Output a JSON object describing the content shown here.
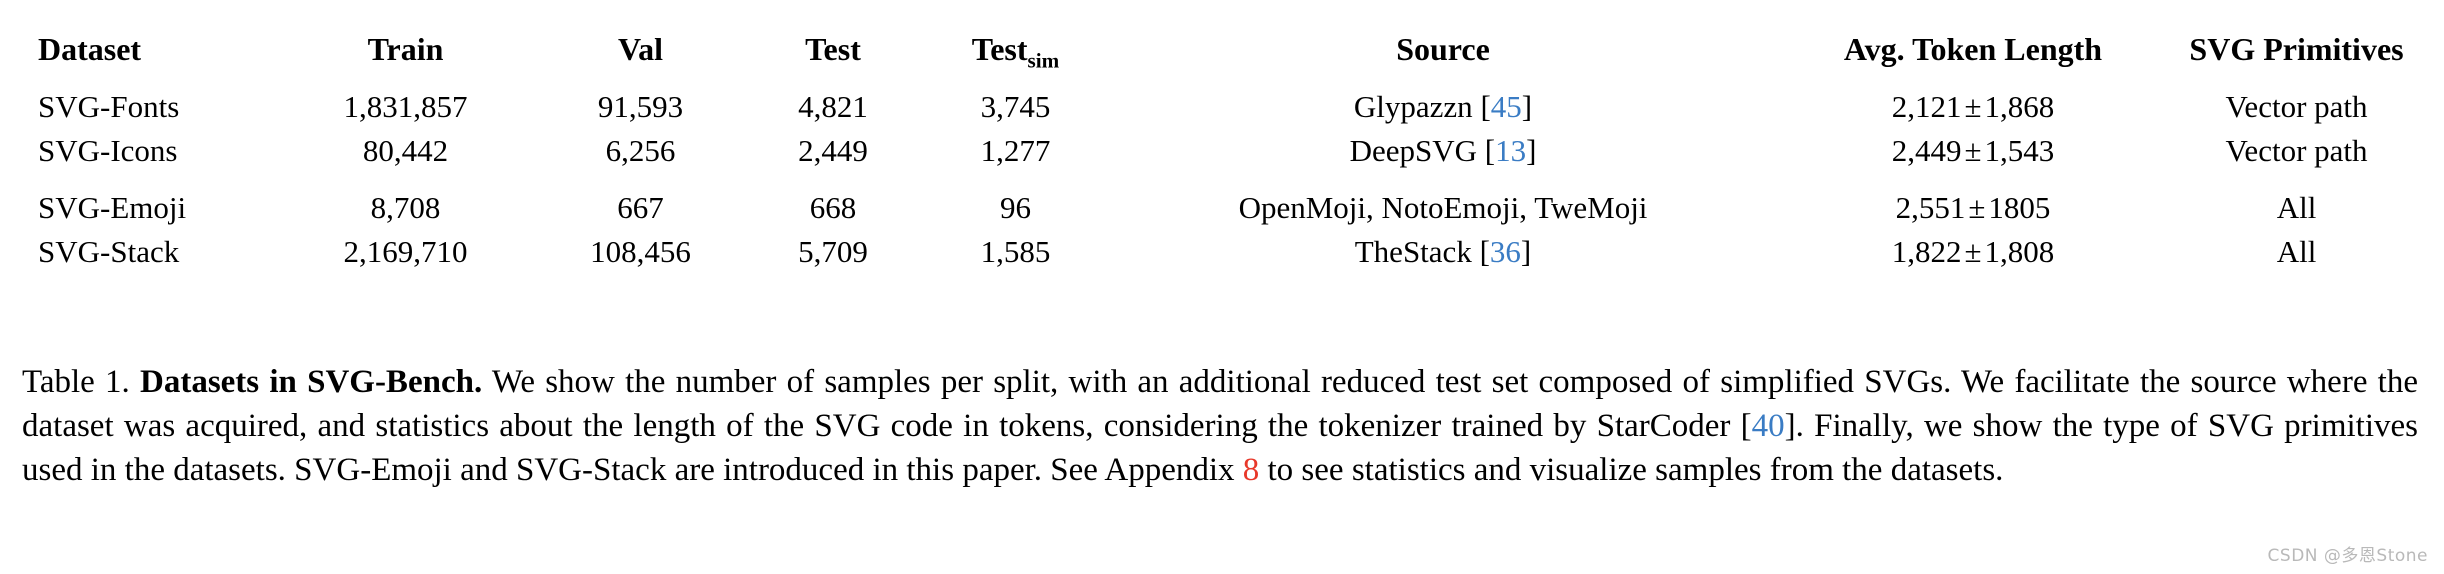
{
  "table": {
    "columns": [
      {
        "key": "dataset",
        "label": "Dataset"
      },
      {
        "key": "train",
        "label": "Train"
      },
      {
        "key": "val",
        "label": "Val"
      },
      {
        "key": "test",
        "label": "Test"
      },
      {
        "key": "testsim",
        "label": "Test",
        "sub": "sim"
      },
      {
        "key": "source",
        "label": "Source"
      },
      {
        "key": "tokens",
        "label": "Avg. Token Length"
      },
      {
        "key": "primitives",
        "label": "SVG Primitives"
      }
    ],
    "rows": [
      {
        "dataset": "SVG-Fonts",
        "train": "1,831,857",
        "val": "91,593",
        "test": "4,821",
        "testsim": "3,745",
        "source_text": "Glypazzn",
        "source_cite": "45",
        "tokens_mean": "2,121",
        "tokens_std": "1,868",
        "primitives": "Vector path"
      },
      {
        "dataset": "SVG-Icons",
        "train": "80,442",
        "val": "6,256",
        "test": "2,449",
        "testsim": "1,277",
        "source_text": "DeepSVG",
        "source_cite": "13",
        "tokens_mean": "2,449",
        "tokens_std": "1,543",
        "primitives": "Vector path"
      },
      {
        "dataset": "SVG-Emoji",
        "train": "8,708",
        "val": "667",
        "test": "668",
        "testsim": "96",
        "source_text": "OpenMoji, NotoEmoji, TweMoji",
        "source_cite": "",
        "tokens_mean": "2,551",
        "tokens_std": "1805",
        "primitives": "All"
      },
      {
        "dataset": "SVG-Stack",
        "train": "2,169,710",
        "val": "108,456",
        "test": "5,709",
        "testsim": "1,585",
        "source_text": "TheStack",
        "source_cite": "36",
        "tokens_mean": "1,822",
        "tokens_std": "1,808",
        "primitives": "All"
      }
    ]
  },
  "caption": {
    "label": "Table 1.",
    "title": "Datasets in SVG-Bench.",
    "body_1": "We show the number of samples per split, with an additional reduced test set composed of simplified SVGs. We facilitate the source where the dataset was acquired, and statistics about the length of the SVG code in tokens, considering the tokenizer trained by StarCoder [",
    "cite_starcoder": "40",
    "body_2": "]. Finally, we show the type of SVG primitives used in the datasets. SVG-Emoji and SVG-Stack are introduced in this paper. See Appendix ",
    "cite_appendix": "8",
    "body_3": " to see statistics and visualize samples from the datasets."
  },
  "watermark": {
    "text": "CSDN @多恩Stone"
  },
  "symbols": {
    "plus_minus": "±"
  },
  "colors": {
    "citation_blue": "#3a7cc4",
    "citation_red": "#e8382a",
    "rule_black": "#000000",
    "watermark_gray": "#b9b9b9"
  }
}
